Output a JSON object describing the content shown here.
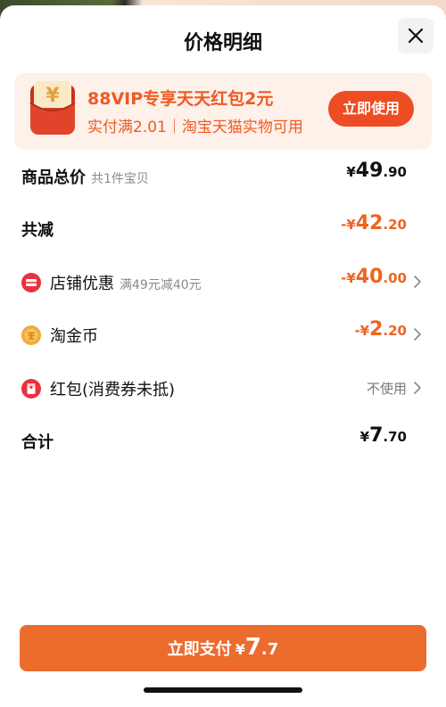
{
  "header": {
    "title": "价格明细"
  },
  "promo": {
    "title": "88VIP专享天天红包2元",
    "subtitle": "实付满2.01｜淘宝天猫实物可用",
    "button_label": "立即使用",
    "icon": "hongbao-yen-icon",
    "icon_glyph": "¥"
  },
  "rows": {
    "total_goods": {
      "label": "商品总价",
      "hint": "共1件宝贝",
      "symbol": "¥",
      "int": "49",
      "dec": ".90"
    },
    "total_discount": {
      "label": "共减",
      "symbol": "-¥",
      "int": "42",
      "dec": ".20"
    },
    "store_discount": {
      "label": "店铺优惠",
      "hint": "满49元减40元",
      "symbol": "-¥",
      "int": "40",
      "dec": ".00",
      "icon": "store-discount-icon"
    },
    "taojinbi": {
      "label": "淘金币",
      "symbol": "-¥",
      "int": "2",
      "dec": ".20",
      "icon": "taojinbi-coin-icon"
    },
    "hongbao": {
      "label": "红包(消费券未抵)",
      "value": "不使用",
      "icon": "red-packet-icon"
    },
    "total": {
      "label": "合计",
      "symbol": "¥",
      "int": "7",
      "dec": ".70"
    }
  },
  "pay_button": {
    "label": "立即支付",
    "symbol": "¥",
    "int": "7",
    "dec": ".7"
  },
  "colors": {
    "accent": "#EC6C2E",
    "promo_text": "#EF5A24",
    "promo_bg": "#FDF1EA",
    "discount": "#F0641E"
  }
}
